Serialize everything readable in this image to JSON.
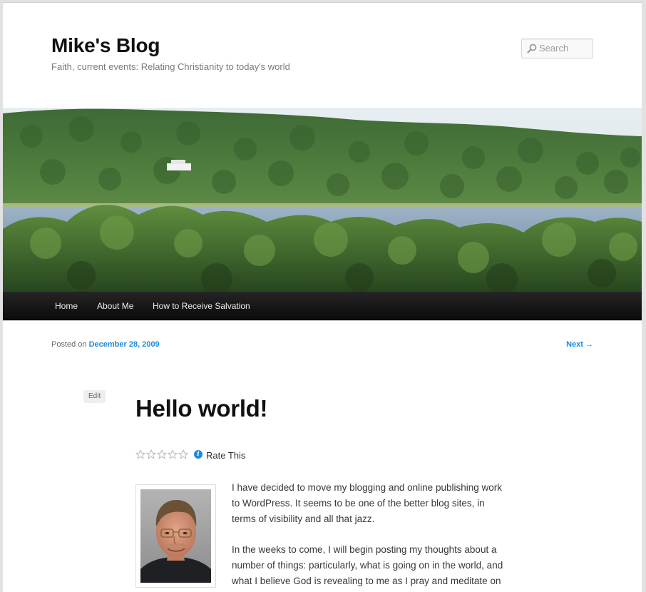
{
  "site": {
    "title": "Mike's Blog",
    "description": "Faith, current events: Relating Christianity to today's world"
  },
  "search": {
    "placeholder": "Search",
    "icon": "search-icon"
  },
  "nav": {
    "items": [
      {
        "label": "Home"
      },
      {
        "label": "About Me"
      },
      {
        "label": "How to Receive Salvation"
      }
    ]
  },
  "post": {
    "posted_on_label": "Posted on",
    "date": "December 28, 2009",
    "next_label": "Next →",
    "edit_label": "Edit",
    "title": "Hello world!",
    "rating": {
      "label": "Rate This",
      "stars": 0,
      "max_stars": 5,
      "info_icon": "info-icon"
    },
    "paragraphs": [
      "I have decided to move my blogging and online publishing work to WordPress. It seems to be one of the better blog sites, in terms of visibility and all that jazz.",
      "In the weeks to come, I will begin posting my thoughts about a number of things: particularly, what is going on in the world, and what I believe God is revealing to me as I pray and meditate on"
    ]
  },
  "colors": {
    "link": "#1b8be0",
    "nav_bg": "#111111",
    "background": "#e2e2e2"
  }
}
